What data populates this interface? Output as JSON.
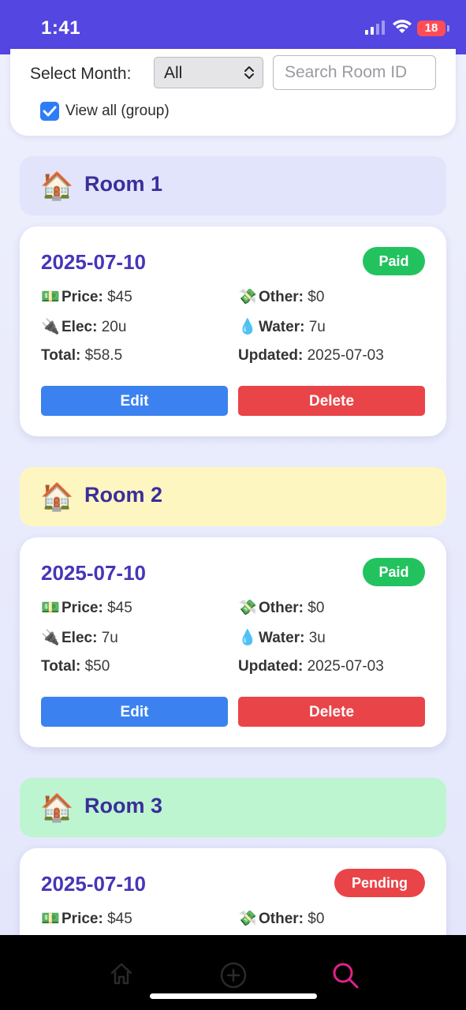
{
  "status_bar": {
    "time": "1:41",
    "battery": "18"
  },
  "filter": {
    "month_label": "Select Month:",
    "month_value": "All",
    "search_placeholder": "Search Room ID",
    "view_all_label": "View all (group)",
    "view_all_checked": true
  },
  "labels": {
    "price": "Price:",
    "other": "Other:",
    "elec": "Elec:",
    "water": "Water:",
    "total": "Total:",
    "updated": "Updated:",
    "edit": "Edit",
    "delete": "Delete"
  },
  "rooms": [
    {
      "name": "Room 1",
      "header_color": "#e2e4fc",
      "bill": {
        "date": "2025-07-10",
        "status": "Paid",
        "status_color": "#22c35e",
        "price": "$45",
        "other": "$0",
        "elec": "20u",
        "water": "7u",
        "total": "$58.5",
        "updated": "2025-07-03"
      }
    },
    {
      "name": "Room 2",
      "header_color": "#fdf6c1",
      "bill": {
        "date": "2025-07-10",
        "status": "Paid",
        "status_color": "#22c35e",
        "price": "$45",
        "other": "$0",
        "elec": "7u",
        "water": "3u",
        "total": "$50",
        "updated": "2025-07-03"
      }
    },
    {
      "name": "Room 3",
      "header_color": "#bcf5d0",
      "bill": {
        "date": "2025-07-10",
        "status": "Pending",
        "status_color": "#e94448",
        "price": "$45",
        "other": "$0"
      }
    }
  ],
  "tab_bar": {
    "items": [
      "home-icon",
      "add-icon",
      "search-icon"
    ],
    "active": "search-icon",
    "active_color": "#e0218a"
  }
}
